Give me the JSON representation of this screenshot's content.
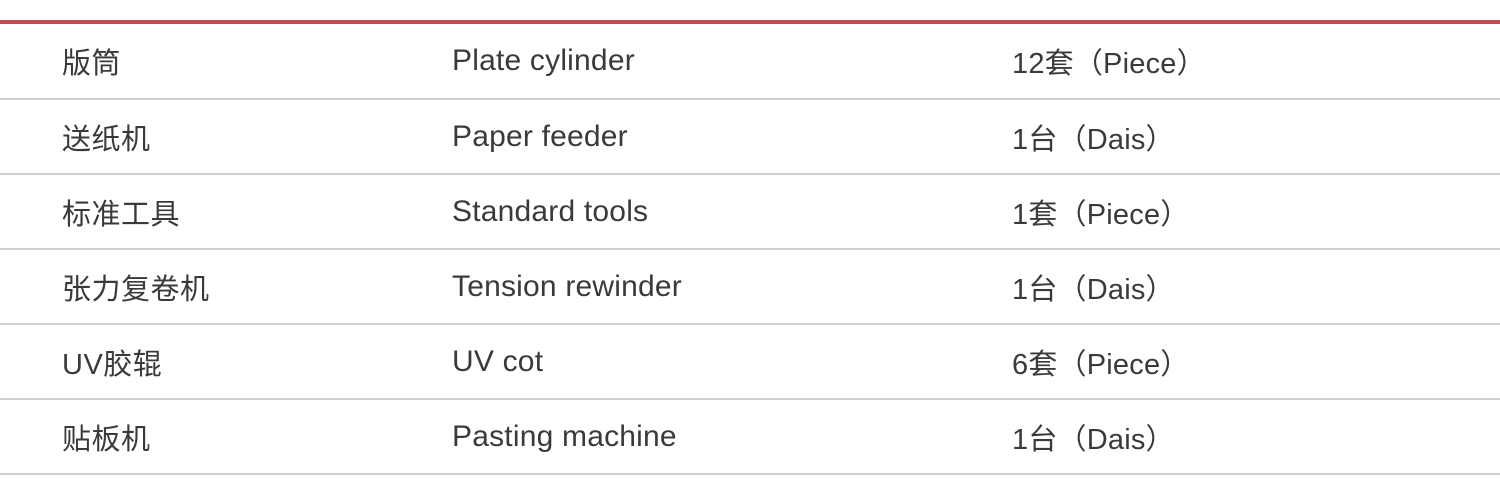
{
  "document": {
    "kind": "equipment-spec-table",
    "accent_color": "#bf4a50",
    "rule_color": "#cfcfcf",
    "text_color": "#3a3a3a"
  },
  "table": {
    "columns": [
      {
        "key": "name_cn",
        "header": ""
      },
      {
        "key": "name_en",
        "header": ""
      },
      {
        "key": "quantity",
        "header": ""
      }
    ],
    "rows": [
      {
        "name_cn": "版筒",
        "name_en": "Plate cylinder",
        "quantity": "12套（Piece）"
      },
      {
        "name_cn": "送纸机",
        "name_en": "Paper feeder",
        "quantity": "1台（Dais）"
      },
      {
        "name_cn": "标准工具",
        "name_en": "Standard tools",
        "quantity": "1套（Piece）"
      },
      {
        "name_cn": "张力复卷机",
        "name_en": "Tension rewinder",
        "quantity": "1台（Dais）"
      },
      {
        "name_cn": "UV胶辊",
        "name_en": "UV cot",
        "quantity": "6套（Piece）"
      },
      {
        "name_cn": "贴板机",
        "name_en": "Pasting machine",
        "quantity": "1台（Dais）"
      }
    ]
  }
}
